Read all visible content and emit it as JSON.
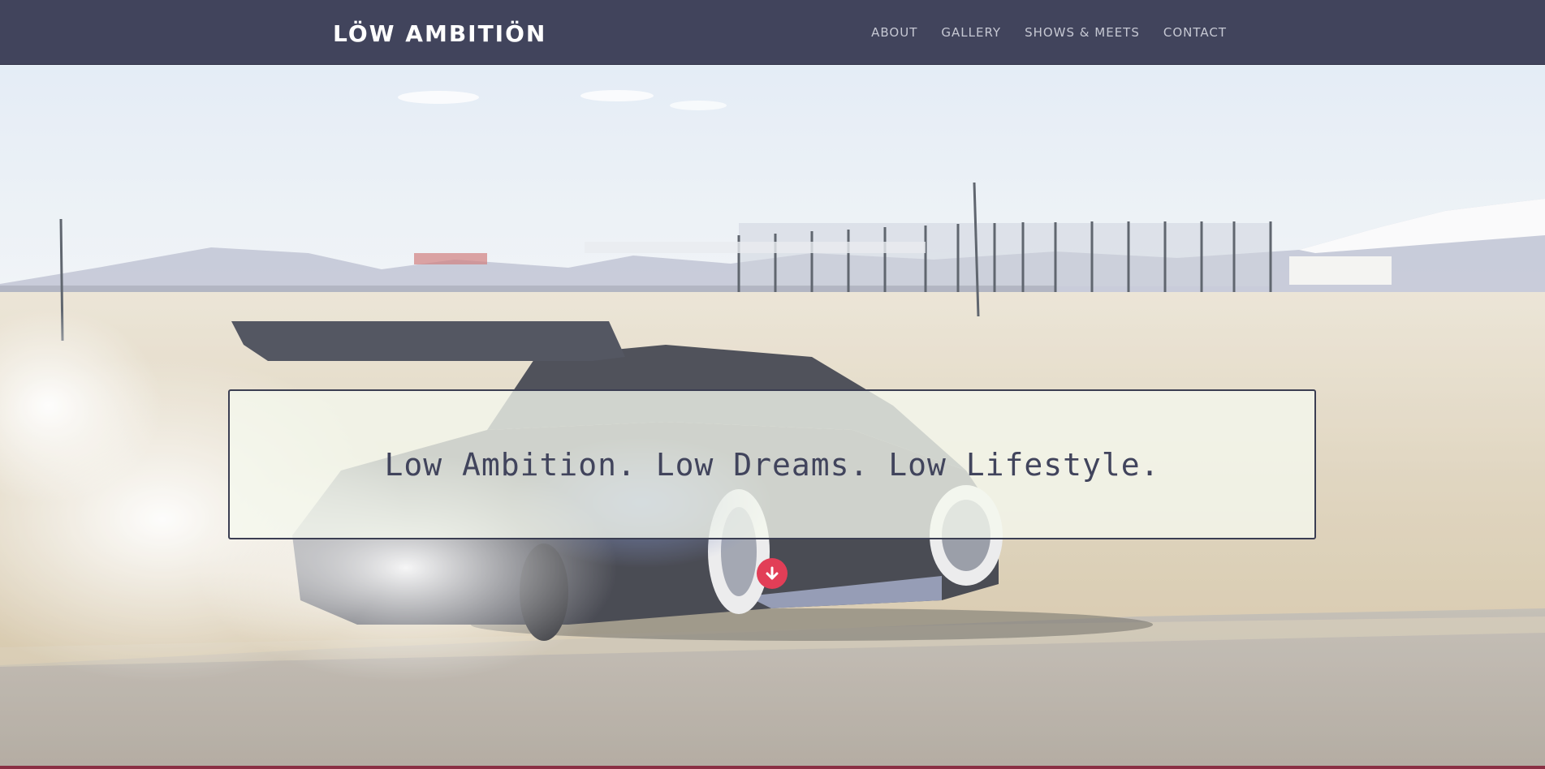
{
  "header": {
    "brand": "LÖW AMBITIÖN",
    "nav": [
      {
        "label": "ABOUT"
      },
      {
        "label": "GALLERY"
      },
      {
        "label": "SHOWS & MEETS"
      },
      {
        "label": "CONTACT"
      }
    ]
  },
  "hero": {
    "tagline": "Low Ambition. Low Dreams. Low Lifestyle.",
    "scroll_icon": "arrow-down-circle-icon"
  },
  "colors": {
    "nav_bg": "#41445c",
    "accent": "#e23e57",
    "text_dark": "#41445c"
  }
}
